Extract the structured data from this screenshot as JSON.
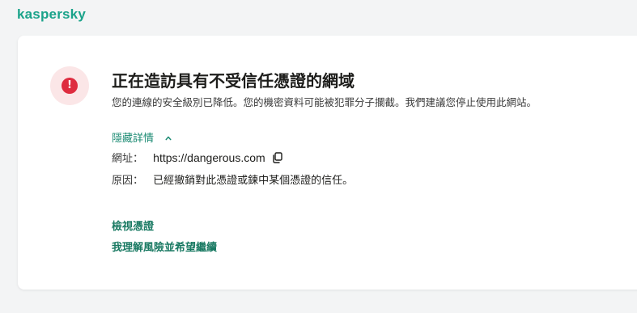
{
  "brand": {
    "logo_text": "kaspersky",
    "accent": "#1aa38a"
  },
  "alert": {
    "icon": "exclamation-icon",
    "icon_glyph": "!",
    "icon_color": "#de2c3f",
    "title": "正在造訪具有不受信任憑證的網域",
    "description": "您的連線的安全級別已降低。您的機密資料可能被犯罪分子攔截。我們建議您停止使用此網站。"
  },
  "details": {
    "toggle_label": "隱藏詳情",
    "url_label": "網址：",
    "url_value": "https://dangerous.com",
    "reason_label": "原因：",
    "reason_value": "已經撤銷對此憑證或鍊中某個憑證的信任。"
  },
  "actions": {
    "view_certificate": "檢視憑證",
    "accept_risk": "我理解風險並希望繼續"
  }
}
